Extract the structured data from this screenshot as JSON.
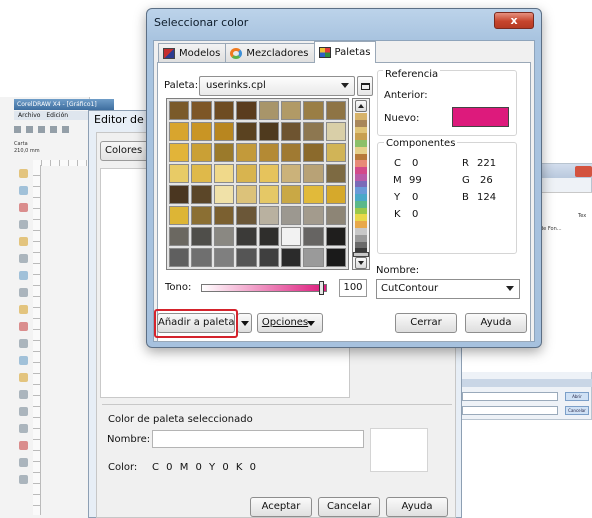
{
  "corel": {
    "title": "CorelDRAW X4 - [Gráfico1]",
    "menu": [
      "Archivo",
      "Edición"
    ],
    "property": [
      "Carta",
      "210,0 mm"
    ]
  },
  "editor": {
    "title": "Editor de paleta",
    "colores_button": "Colores de paleta",
    "selected_group": "Color de paleta seleccionado",
    "nombre_label": "Nombre:",
    "color_label": "Color:",
    "color_value": "C 0   M 0   Y 0   K 0",
    "aceptar": "Aceptar",
    "cancelar": "Cancelar",
    "ayuda": "Ayuda"
  },
  "rightwin": {
    "col_label": "Tex",
    "item": "de Fon...",
    "btn1": "Abrir",
    "btn2": "Cancelar"
  },
  "dialog": {
    "title": "Seleccionar color",
    "close_glyph": "x",
    "tabs": [
      "Modelos",
      "Mezcladores",
      "Paletas"
    ],
    "paleta_label": "Paleta:",
    "paleta_value": "userinks.cpl",
    "referencia_title": "Referencia",
    "anterior_label": "Anterior:",
    "nuevo_label": "Nuevo:",
    "componentes_title": "Componentes",
    "cmyk": {
      "c_label": "C",
      "c": "0",
      "m_label": "M",
      "m": "99",
      "y_label": "Y",
      "y": "0",
      "k_label": "K",
      "k": "0"
    },
    "rgb": {
      "r_label": "R",
      "r": "221",
      "g_label": "G",
      "g": "26",
      "b_label": "B",
      "b": "124"
    },
    "nombre_label": "Nombre:",
    "nombre_value": "CutContour",
    "tono_label": "Tono:",
    "tono_value": "100",
    "tono_level_percent": 100,
    "add_button": "Añadir a paleta",
    "opciones_button": "Opciones",
    "cerrar_button": "Cerrar",
    "ayuda_button": "Ayuda",
    "nuevo_color": "#dd1a7c"
  },
  "palette_swatches": [
    [
      "#7a5a2a",
      "#7d5626",
      "#6e4c22",
      "#5a3c1e",
      "#a8956a",
      "#b19a66",
      "#9a7e45",
      "#8e7445"
    ],
    [
      "#d8a52e",
      "#c99524",
      "#b8861f",
      "#5a4220",
      "#4f3a1e",
      "#6e5430",
      "#8d7750",
      "#d9cfa8"
    ],
    [
      "#e2b439",
      "#caa035",
      "#9b7a2b",
      "#c39a3a",
      "#b48a34",
      "#a07a32",
      "#8b6a2c",
      "#d1b457"
    ],
    [
      "#e8cb66",
      "#dfb94a",
      "#f0d98a",
      "#d8b44f",
      "#e6c35c",
      "#cbb27a",
      "#b8a276",
      "#7d6a42"
    ],
    [
      "#4a3620",
      "#5b4628",
      "#f0e1a8",
      "#dcc27a",
      "#e5c866",
      "#c9a845",
      "#e1ba3a",
      "#d6a92b"
    ],
    [
      "#ddb535",
      "#8b6f33",
      "#7b6030",
      "#6b5738",
      "#b9b1a0",
      "#9c9890",
      "#a39b8d",
      "#8d8576"
    ],
    [
      "#6b6861",
      "#4f4e4a",
      "#8a8882",
      "#3b3a38",
      "#2f2e2c",
      "#f2f2f2",
      "#666462",
      "#1f1e1d"
    ],
    [
      "#5f5f5f",
      "#6f6f6f",
      "#7f7f7f",
      "#555555",
      "#3f3f3f",
      "#2b2b2b",
      "#9a9a9a",
      "#1a1a1a"
    ]
  ],
  "strip_colors": [
    "#d7b36a",
    "#a8865a",
    "#e0c478",
    "#c8a050",
    "#8cc06a",
    "#e6d08a",
    "#b77a3a",
    "#e88a78",
    "#d24a8a",
    "#b85ca8",
    "#7a6ab8",
    "#6a9ad8",
    "#4aa8c8",
    "#5ab88a",
    "#9ac84a",
    "#e8d84a",
    "#e8a84a",
    "#c8c8c8",
    "#9a9a9a",
    "#6a6a6a",
    "#3a3a3a"
  ]
}
